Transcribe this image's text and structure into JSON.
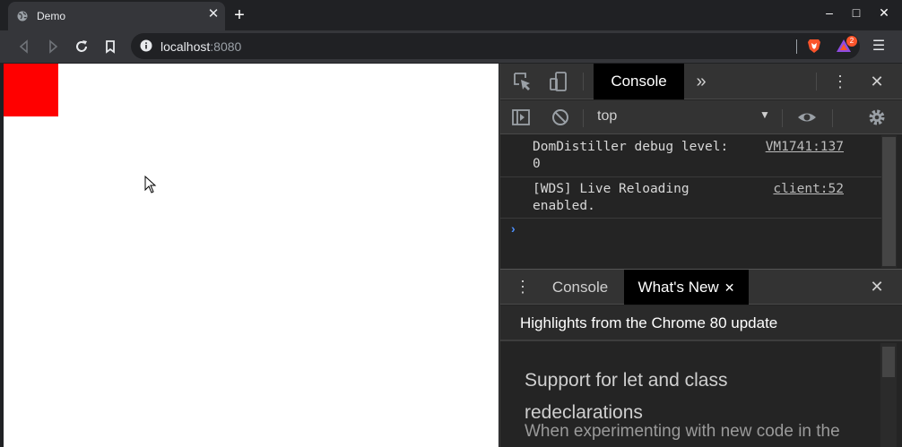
{
  "browser": {
    "tab_title": "Demo",
    "new_tab_symbol": "+",
    "window_controls": {
      "minimize": "–",
      "maximize": "□",
      "close": "✕"
    },
    "url_host": "localhost",
    "url_port": ":8080",
    "rewards_badge": "2"
  },
  "devtools": {
    "main_tab": "Console",
    "more_tabs": "»",
    "context": "top",
    "messages": [
      {
        "text": "DomDistiller debug level: 0",
        "source": "VM1741:137"
      },
      {
        "text": "[WDS] Live Reloading enabled.",
        "source": "client:52"
      }
    ],
    "prompt_symbol": "›",
    "drawer_tabs": {
      "console": "Console",
      "whats_new": "What's New"
    },
    "whats_new": {
      "header": "Highlights from the Chrome 80 update",
      "title": "Support for let and class redeclarations",
      "description": "When experimenting with new code in the Console, repeating let and class"
    }
  },
  "colors": {
    "page_square": "#ff0000",
    "brave_orange": "#fb542b",
    "prompt_blue": "#4d90fe"
  }
}
